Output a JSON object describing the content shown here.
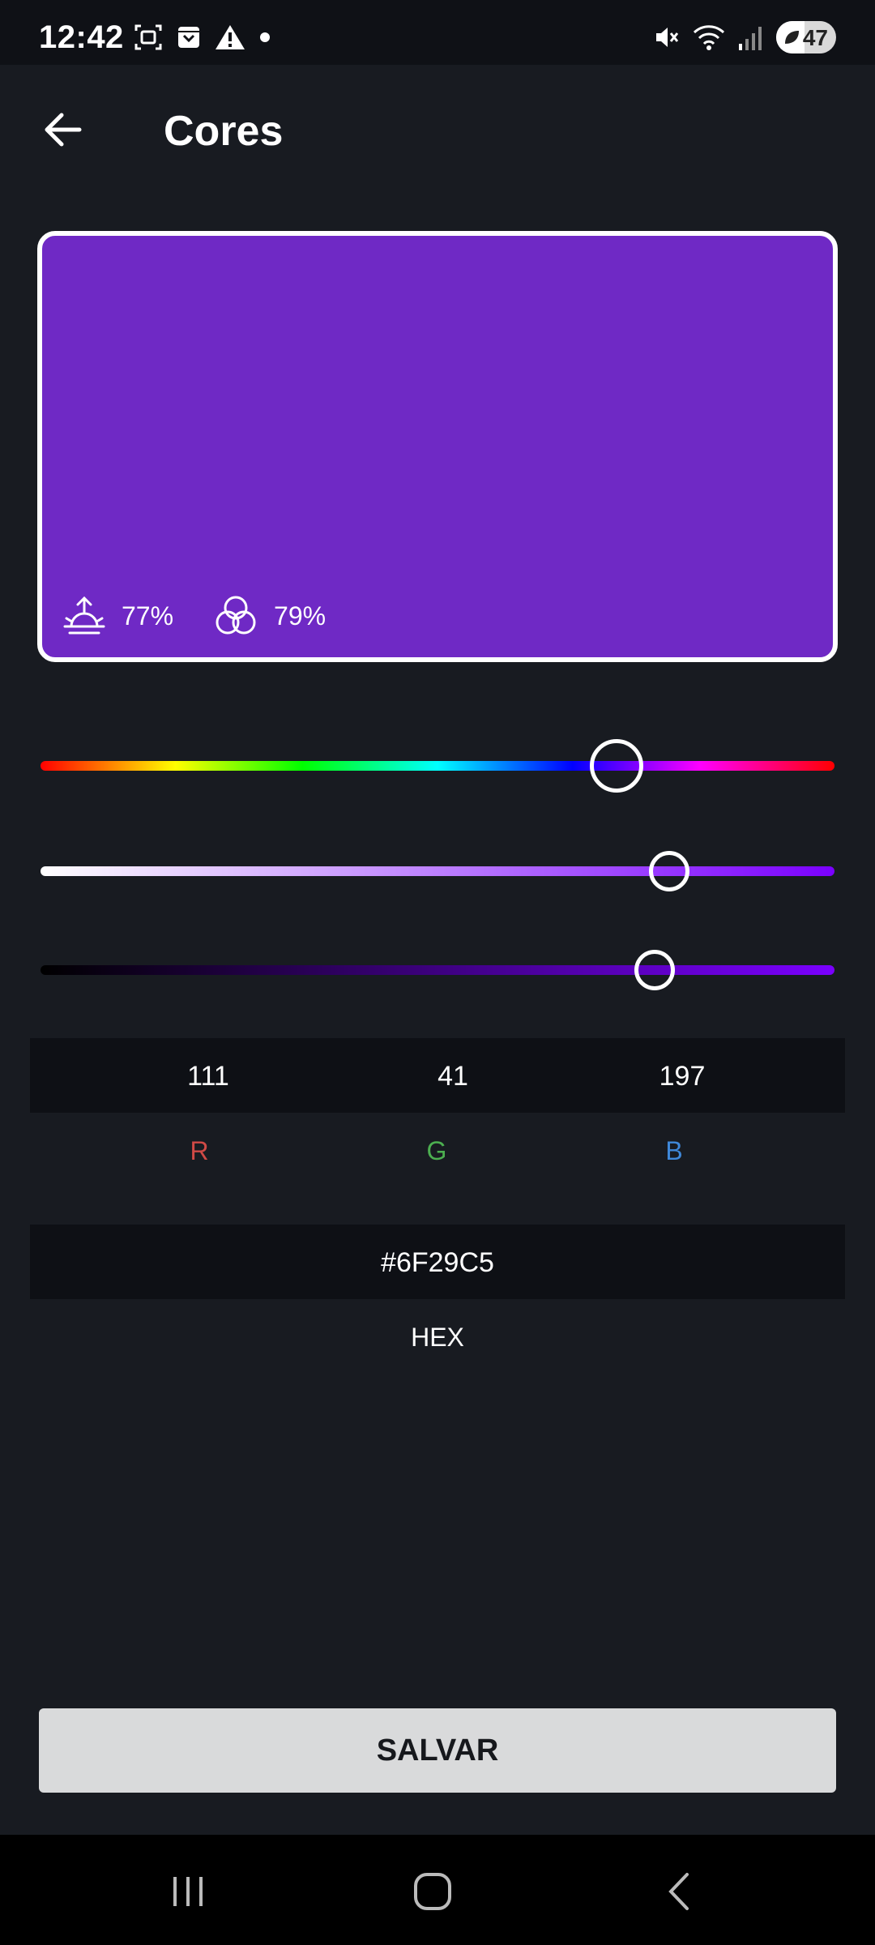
{
  "status": {
    "time": "12:42",
    "battery": "47",
    "battery_level": 0.47
  },
  "appbar": {
    "title": "Cores"
  },
  "preview": {
    "color": "#6F29C5",
    "brightness": "77%",
    "saturation": "79%"
  },
  "sliders": {
    "hue_position": 0.725,
    "saturation_position": 0.792,
    "value_position": 0.773,
    "accent": "#7a00ff"
  },
  "rgb": {
    "r_value": "111",
    "g_value": "41",
    "b_value": "197",
    "r_label": "R",
    "g_label": "G",
    "b_label": "B",
    "r_color": "#d04a46",
    "g_color": "#4caf50",
    "b_color": "#3f88d9"
  },
  "hex": {
    "value": "#6F29C5",
    "label": "HEX"
  },
  "actions": {
    "save_label": "SALVAR"
  }
}
